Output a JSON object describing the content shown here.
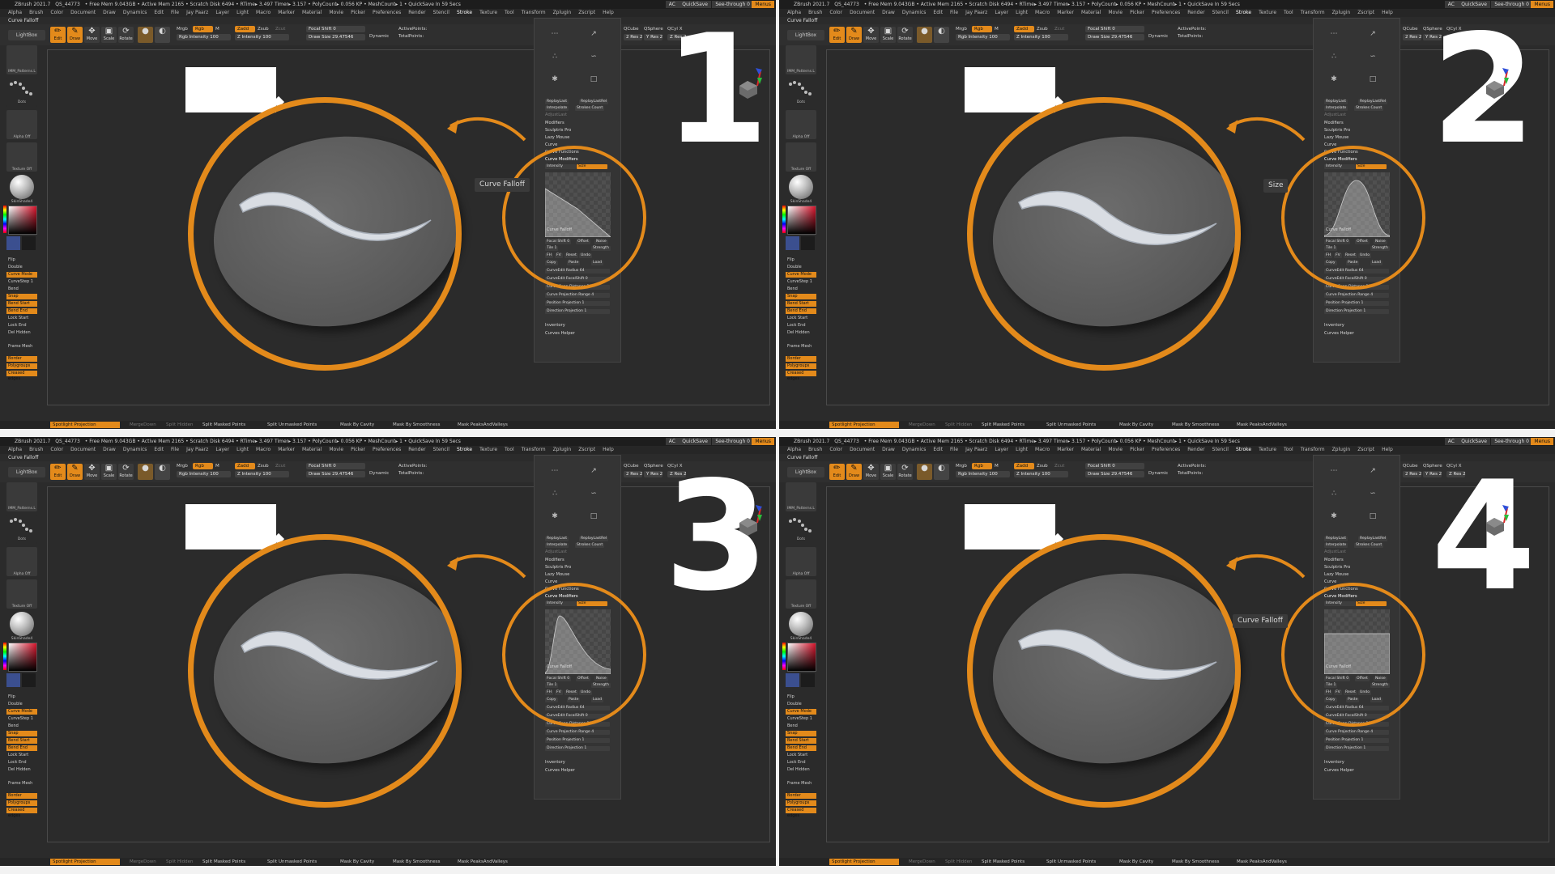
{
  "accent": "#e38a1b",
  "background": "#2b2b2b",
  "app": {
    "title": "ZBrush 2021.7",
    "stats_left": "QS_44773",
    "stats_mid": "• Free Mem 9.043GB • Active Mem 2165 • Scratch Disk 6494 • RTime▸ 3.497 Timer▸ 3.157 • PolyCount▸ 0.056 KP • MeshCount▸ 1 • QuickSave In 59 Secs",
    "quicksave_label": "QuickSave",
    "seethrough_label": "See-through 0",
    "menus_button": "Menus",
    "ac_label": "AC"
  },
  "menus": [
    "Alpha",
    "Brush",
    "Color",
    "Document",
    "Draw",
    "Dynamics",
    "Edit",
    "File",
    "Jay Paarz",
    "Layer",
    "Light",
    "Macro",
    "Marker",
    "Material",
    "Movie",
    "Picker",
    "Preferences",
    "Render",
    "Stencil",
    "Stroke",
    "Texture",
    "Tool",
    "Transform",
    "Zplugin",
    "Zscript",
    "Help"
  ],
  "active_menu": "Stroke",
  "subtitle": "Curve Falloff",
  "toolbar": {
    "lightbox": "LightBox",
    "edit": "Edit",
    "draw": "Draw",
    "move": "Move",
    "scale": "Scale",
    "rotate": "Rotate",
    "mrgb": "Mrgb",
    "rgb": "Rgb",
    "m": "M",
    "rgb_intensity": "Rgb Intensity 100",
    "zadd": "Zadd",
    "zsub": "Zsub",
    "zcut": "Zcut",
    "z_intensity": "Z Intensity 100",
    "focal_shift": "Focal Shift 0",
    "draw_size": "Draw Size 29.47546",
    "dynamic": "Dynamic",
    "active_points": "ActivePoints:",
    "total_points": "TotalPoints:",
    "qcube": "QCube",
    "qsphere": "QSphere",
    "qcyl": "QCyl X",
    "res": "2 Res 2",
    "yres": "Y Res 2",
    "zres": "Z Res 2"
  },
  "left_shelf": {
    "brush_label": "IMM_Patterns.L",
    "stroke_label": "Dots",
    "alpha_label": "Alpha Off",
    "texture_label": "Texture Off",
    "material_label": "SkinShade4",
    "buttons": [
      "Flip",
      "Double",
      "Curve Mode",
      "CurveStep 1",
      "Bend",
      "Snap",
      "Bend Start",
      "Bend End",
      "Lock Start",
      "Lock End",
      "Del Hidden",
      "Frame Mesh",
      "Border",
      "Polygroups",
      "Creased edges"
    ],
    "orange_buttons": [
      "Curve Mode",
      "Snap",
      "Bend Start",
      "Bend End",
      "Border",
      "Polygroups",
      "Creased edges"
    ]
  },
  "stroke_palette": {
    "icons": [
      "Dots",
      "DragRect",
      "Spray",
      "FreeHand",
      "Color",
      "DragDot"
    ],
    "replay_last": "ReplayLast",
    "replay_last_rel": "ReplayLastRel",
    "interpolate": "Interpolate",
    "strokes_count": "Strokes Count",
    "adjustlast": "AdjustLast",
    "modifiers": "Modifiers",
    "sculptris_pro": "Sculptris Pro",
    "lazy_mouse": "Lazy Mouse",
    "curve": "Curve",
    "curve_functions": "Curve Functions",
    "curve_modifiers": "Curve Modifiers",
    "intensity": "Intensity",
    "size": "Size",
    "graph_label": "Curve Falloff",
    "focal_shift": "Focal Shift 0",
    "offset": "Offset",
    "noise": "Noise",
    "tile": "Tile 1",
    "strength": "Strength",
    "buttons_row": [
      "FH",
      "FV",
      "Reset",
      "Undo"
    ],
    "copy_paste": [
      "Copy",
      "Paste",
      "Load"
    ],
    "edit_radius": "CurveEdit Radius 64",
    "edit_focal": "CurveEdit FocalShift 0",
    "snap_distance": "Curve Snap Distance 25",
    "projection_range": "Curve Projection Range 4",
    "position_projection": "Position Projection 1",
    "direction_projection": "Direction Projection 1",
    "inventory": "Inventory",
    "curves_helper": "Curves Helper"
  },
  "statusbar": {
    "spotlight": "Spotlight Projection",
    "mergeboundary": "MergeDown",
    "split_hidden": "Split Hidden",
    "split_masked": "Split Masked Points",
    "split_unmasked": "Split Unmasked Points",
    "mask_cavity": "Mask By Cavity",
    "mask_smoothness": "Mask By Smoothness",
    "mask_peaks": "Mask PeaksAndValleys"
  },
  "panels": [
    {
      "number": "1",
      "tooltip": "Curve Falloff",
      "tooltip_visible": true,
      "stroke": "taper"
    },
    {
      "number": "2",
      "tooltip": "Size",
      "tooltip_visible": true,
      "stroke": "bell"
    },
    {
      "number": "3",
      "tooltip": "",
      "tooltip_visible": false,
      "stroke": "peak-left"
    },
    {
      "number": "4",
      "tooltip": "Curve Falloff",
      "tooltip_visible": true,
      "stroke": "flat"
    }
  ]
}
